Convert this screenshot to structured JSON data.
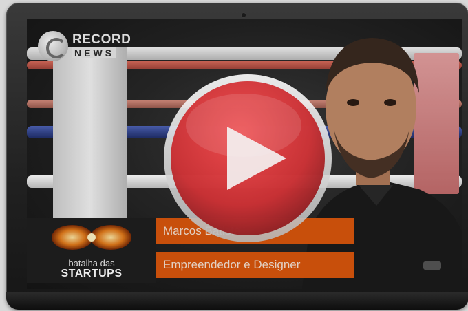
{
  "video": {
    "channel_logo": {
      "line1": "RECORD",
      "line2": "NEWS"
    },
    "program": {
      "line1": "batalha das",
      "line2": "STARTUPS"
    },
    "person_name": "Marcos Batista",
    "person_role": "Empreendedor e Designer"
  },
  "controls": {
    "play_icon": "play-icon"
  },
  "colors": {
    "accent": "#d9560d",
    "play_red": "#d8262a"
  }
}
